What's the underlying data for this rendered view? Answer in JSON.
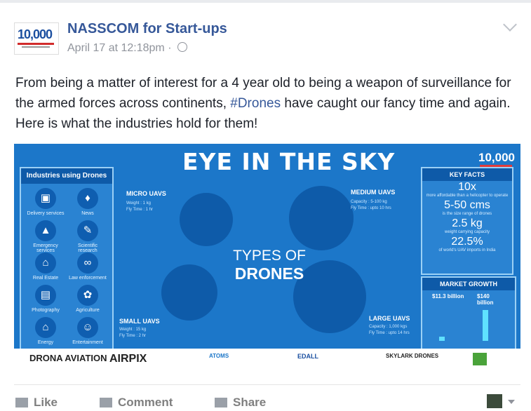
{
  "post": {
    "author": "NASSCOM for Start-ups",
    "avatar_text": "10,000",
    "timestamp": "April 17 at 12:18pm",
    "text_before": "From being a matter of interest for a 4 year old to being a weapon of surveillance for the armed forces across continents, ",
    "hashtag": "#Drones",
    "text_after": " have caught our fancy time and again. Here is what the industries hold for them!"
  },
  "infographic": {
    "title": "EYE IN THE SKY",
    "logo": "10,000",
    "left_panel_title": "Industries using Drones",
    "industries": [
      "Delivery services",
      "News",
      "Emergency services",
      "Scientific research",
      "Real Estate",
      "Law enforcement",
      "Photography",
      "Agriculture",
      "Energy",
      "Entertainment"
    ],
    "center_line1": "TYPES OF",
    "center_line2": "DRONES",
    "drones": {
      "micro": {
        "label": "MICRO UAVS",
        "l1": "Weight : 1 kg",
        "l2": "Fly Time : 1 hr"
      },
      "medium": {
        "label": "MEDIUM UAVS",
        "l1": "Capacity : 5-100 kg",
        "l2": "Fly Time : upto 10 hrs"
      },
      "small": {
        "label": "SMALL UAVS",
        "l1": "Weight : 15 kg",
        "l2": "Fly Time : 2 hr"
      },
      "large": {
        "label": "LARGE UAVS",
        "l1": "Capacity : 1,000 kgs",
        "l2": "Fly Time : upto 14 hrs"
      }
    },
    "key_facts_title": "KEY FACTS",
    "facts": [
      {
        "big": "10x",
        "small": "more affordable than a helicopter to operate"
      },
      {
        "big": "5-50 cms",
        "small": "is the size range of drones"
      },
      {
        "big": "2.5 kg",
        "small": "weight carrying capacity"
      },
      {
        "big": "22.5%",
        "small": "of world's UAV imports in India"
      }
    ],
    "market_title": "MARKET GROWTH",
    "market_v1": "$11.3 billion",
    "market_v2": "$140 billion",
    "partners": [
      "DRONA AVIATION",
      "AIRPIX",
      "ATOMS",
      "EDALL",
      "SKYLARK DRONES",
      ""
    ]
  },
  "actions": {
    "like": "Like",
    "comment": "Comment",
    "share": "Share"
  }
}
